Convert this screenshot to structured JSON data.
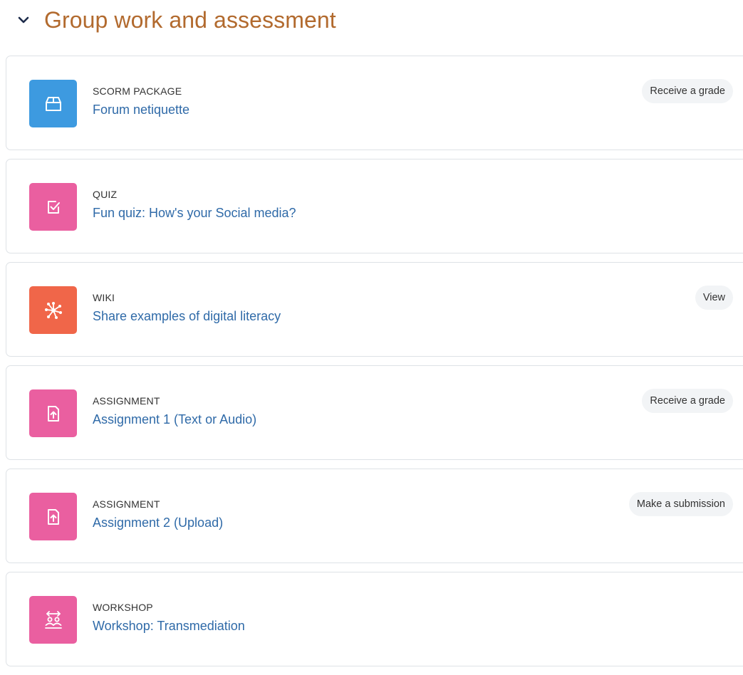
{
  "section": {
    "title": "Group work and assessment",
    "toggle_icon": "chevron-down-icon"
  },
  "colors": {
    "title": "#b26a2e",
    "link": "#2f6aa8",
    "scorm": "#3d9ae0",
    "quiz": "#ea5fa0",
    "wiki": "#f06649",
    "assignment": "#ea5fa0",
    "workshop": "#ea5fa0"
  },
  "activities": [
    {
      "type": "SCORM PACKAGE",
      "name": "Forum netiquette",
      "icon": "package-icon",
      "badge": "Receive a grade"
    },
    {
      "type": "QUIZ",
      "name": "Fun quiz: How's your Social media?",
      "icon": "quiz-checkbox-icon"
    },
    {
      "type": "WIKI",
      "name": "Share examples of digital literacy",
      "icon": "wiki-network-icon",
      "badge": "View"
    },
    {
      "type": "ASSIGNMENT",
      "name": "Assignment 1 (Text or Audio)",
      "icon": "assignment-upload-icon",
      "badge": "Receive a grade"
    },
    {
      "type": "ASSIGNMENT",
      "name": "Assignment 2 (Upload)",
      "icon": "assignment-upload-icon",
      "badge": "Make a submission"
    },
    {
      "type": "WORKSHOP",
      "name": "Workshop: Transmediation",
      "icon": "workshop-people-icon"
    }
  ]
}
